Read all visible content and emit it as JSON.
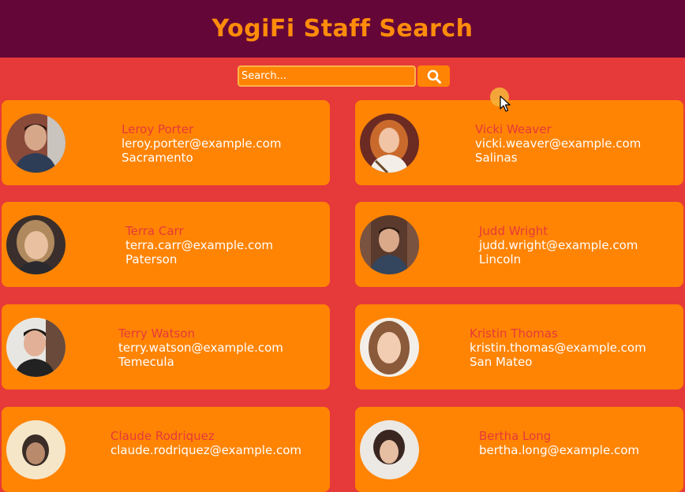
{
  "header": {
    "title": "YogiFi Staff Search"
  },
  "search": {
    "placeholder": "Search..."
  },
  "employees": [
    {
      "name": "Leroy Porter",
      "email": "leroy.porter@example.com",
      "city": "Sacramento"
    },
    {
      "name": "Vicki Weaver",
      "email": "vicki.weaver@example.com",
      "city": "Salinas"
    },
    {
      "name": "Terra Carr",
      "email": "terra.carr@example.com",
      "city": "Paterson"
    },
    {
      "name": "Judd Wright",
      "email": "judd.wright@example.com",
      "city": "Lincoln"
    },
    {
      "name": "Terry Watson",
      "email": "terry.watson@example.com",
      "city": "Temecula"
    },
    {
      "name": "Kristin Thomas",
      "email": "kristin.thomas@example.com",
      "city": "San Mateo"
    },
    {
      "name": "Claude Rodriquez",
      "email": "claude.rodriquez@example.com",
      "city": ""
    },
    {
      "name": "Bertha Long",
      "email": "bertha.long@example.com",
      "city": ""
    }
  ],
  "icons": {
    "search": "search-icon",
    "cursor": "mouse-cursor-icon"
  },
  "colors": {
    "header_bg": "#650638",
    "page_bg": "#e6393a",
    "card_bg": "#ff8404",
    "title": "#ff8c0a",
    "name": "#e6393a",
    "text": "#ffffff"
  }
}
